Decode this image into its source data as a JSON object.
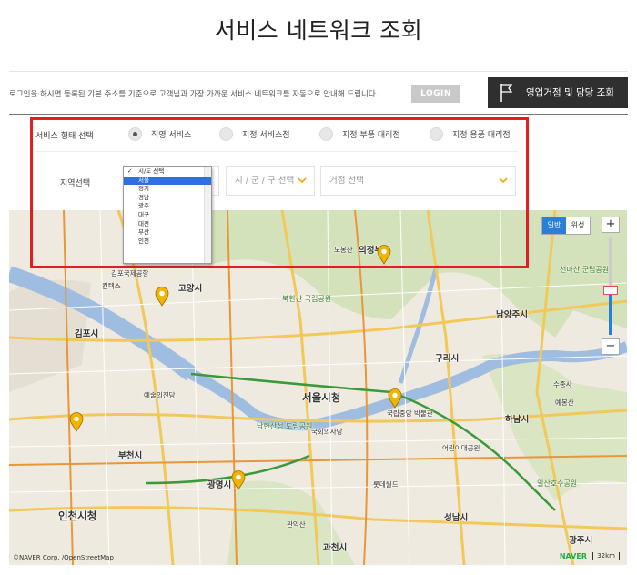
{
  "page": {
    "title": "서비스 네트워크 조회"
  },
  "notice": {
    "text": "로그인을 하시면 등록된 기본 주소를 기준으로 고객님과 가장 가까운 서비스 네트워크를 자동으로 안내해 드립니다.",
    "login_label": "LOGIN"
  },
  "branch_button": {
    "label": "영업거점 및 담당 조회",
    "icon": "flag-icon"
  },
  "service_type": {
    "label": "서비스 형태 선택",
    "options": [
      {
        "label": "직영 서비스",
        "selected": true
      },
      {
        "label": "지정 서비스점",
        "selected": false
      },
      {
        "label": "지정 부품 대리점",
        "selected": false
      },
      {
        "label": "지정 용품 대리점",
        "selected": false
      }
    ]
  },
  "region": {
    "label": "지역선택",
    "sido_options": [
      "시/도 선택",
      "서울",
      "경기",
      "경남",
      "광주",
      "대구",
      "대전",
      "부산",
      "인천"
    ],
    "sido_checked_index": 0,
    "sido_highlight_index": 1,
    "sigungu_placeholder": "시 / 군 / 구 선택",
    "branch_placeholder": "거점 선택"
  },
  "map": {
    "type_options": [
      {
        "label": "일반",
        "active": true
      },
      {
        "label": "위성",
        "active": false
      }
    ],
    "zoom_in": "+",
    "zoom_out": "−",
    "zoom_level_fraction": 0.45,
    "copyright": "©NAVER Corp. /OpenStreetMap",
    "brand": "NAVER",
    "scale": "32km",
    "places": [
      {
        "name": "서울시청",
        "cls": "big"
      },
      {
        "name": "고양시",
        "cls": ""
      },
      {
        "name": "김포시",
        "cls": ""
      },
      {
        "name": "부천시",
        "cls": ""
      },
      {
        "name": "광명시",
        "cls": ""
      },
      {
        "name": "인천시청",
        "cls": "big"
      },
      {
        "name": "구리시",
        "cls": ""
      },
      {
        "name": "남양주시",
        "cls": ""
      },
      {
        "name": "하남시",
        "cls": ""
      },
      {
        "name": "성남시",
        "cls": ""
      },
      {
        "name": "과천시",
        "cls": ""
      },
      {
        "name": "의정부시",
        "cls": ""
      },
      {
        "name": "광주시",
        "cls": ""
      },
      {
        "name": "북한산 국립공원",
        "cls": "green"
      },
      {
        "name": "천마산 군립공원",
        "cls": "green"
      },
      {
        "name": "수종사",
        "cls": "small"
      },
      {
        "name": "예봉산",
        "cls": "small"
      },
      {
        "name": "관악산",
        "cls": "small"
      },
      {
        "name": "도봉산",
        "cls": "small"
      },
      {
        "name": "남한산성 도립공원",
        "cls": "green"
      },
      {
        "name": "국회의사당",
        "cls": "small"
      },
      {
        "name": "국립중앙 박물관",
        "cls": "small"
      },
      {
        "name": "어린이대공원",
        "cls": "small"
      },
      {
        "name": "롯데월드",
        "cls": "small"
      },
      {
        "name": "예술의전당",
        "cls": "small"
      },
      {
        "name": "김포국제공항",
        "cls": "small"
      },
      {
        "name": "킨텍스",
        "cls": "small"
      },
      {
        "name": "일산호수공원",
        "cls": "green"
      }
    ],
    "pins": [
      1,
      2,
      3,
      4,
      5
    ]
  }
}
